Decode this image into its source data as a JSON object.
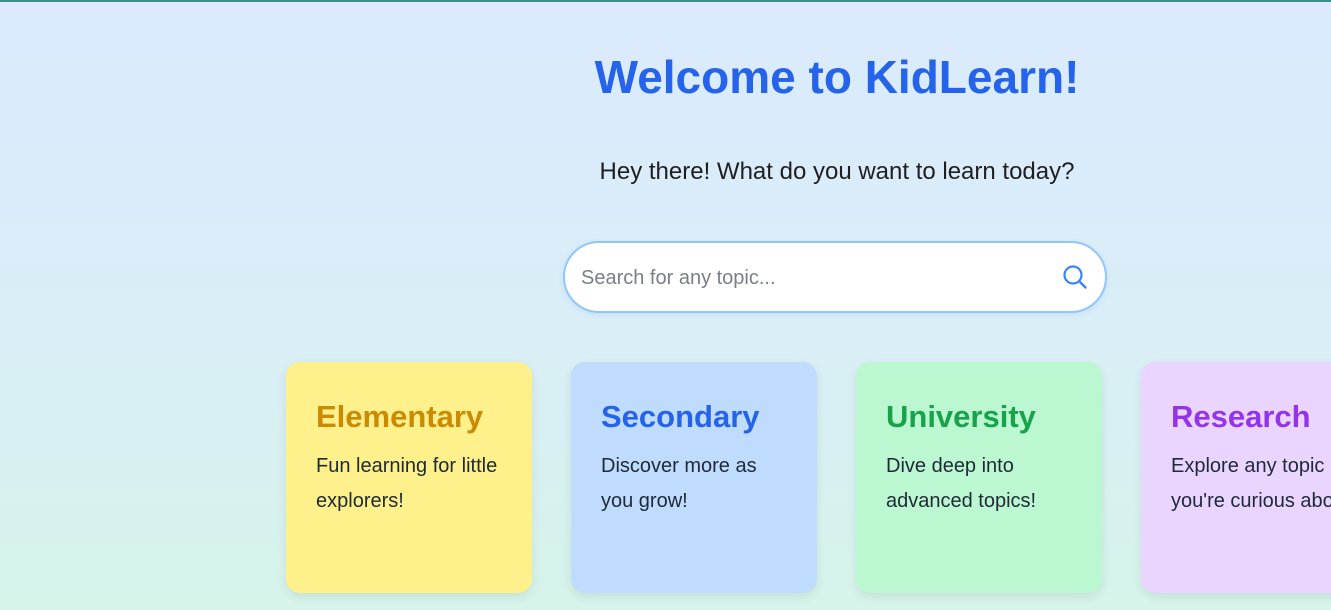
{
  "header": {
    "title": "Welcome to KidLearn!",
    "subtitle": "Hey there! What do you want to learn today?"
  },
  "search": {
    "value": "",
    "placeholder": "Search for any topic...",
    "icon": "search-icon"
  },
  "levels": [
    {
      "title": "Elementary",
      "description": "Fun learning for little explorers!",
      "color": "#ca8a04",
      "background": "#fef08a"
    },
    {
      "title": "Secondary",
      "description": "Discover more as you grow!",
      "color": "#2563eb",
      "background": "#bfdbfe"
    },
    {
      "title": "University",
      "description": "Dive deep into advanced topics!",
      "color": "#16a34a",
      "background": "#bbf7d0"
    },
    {
      "title": "Research",
      "description": "Explore any topic you're curious about!",
      "color": "#9333ea",
      "background": "#e9d5ff"
    }
  ],
  "colors": {
    "accent": "#2563eb",
    "search_border": "#93c5fd"
  }
}
